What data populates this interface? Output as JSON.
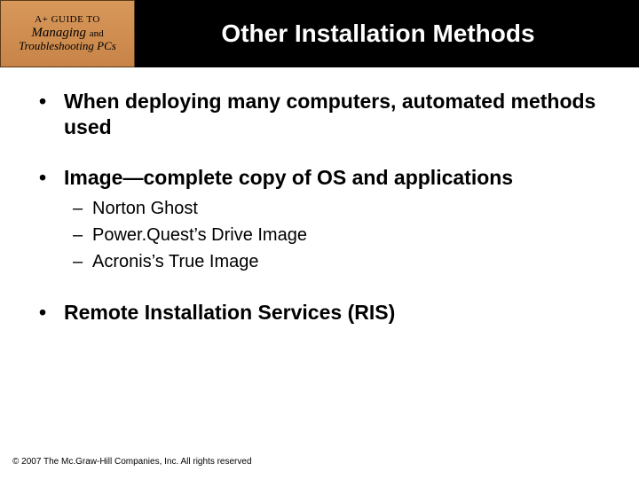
{
  "logo": {
    "line1": "A+ GUIDE TO",
    "line2_a": "Managing",
    "line2_and": "and",
    "line3": "Troubleshooting PCs"
  },
  "title": "Other Installation Methods",
  "bullets": [
    {
      "text": "When deploying many computers, automated methods used",
      "sub": []
    },
    {
      "text": "Image—complete copy of OS and applications",
      "sub": [
        "Norton Ghost",
        "Power.Quest’s Drive Image",
        "Acronis’s True Image"
      ]
    },
    {
      "text": "Remote Installation Services (RIS)",
      "sub": []
    }
  ],
  "footer": "© 2007 The Mc.Graw-Hill Companies, Inc. All rights reserved"
}
